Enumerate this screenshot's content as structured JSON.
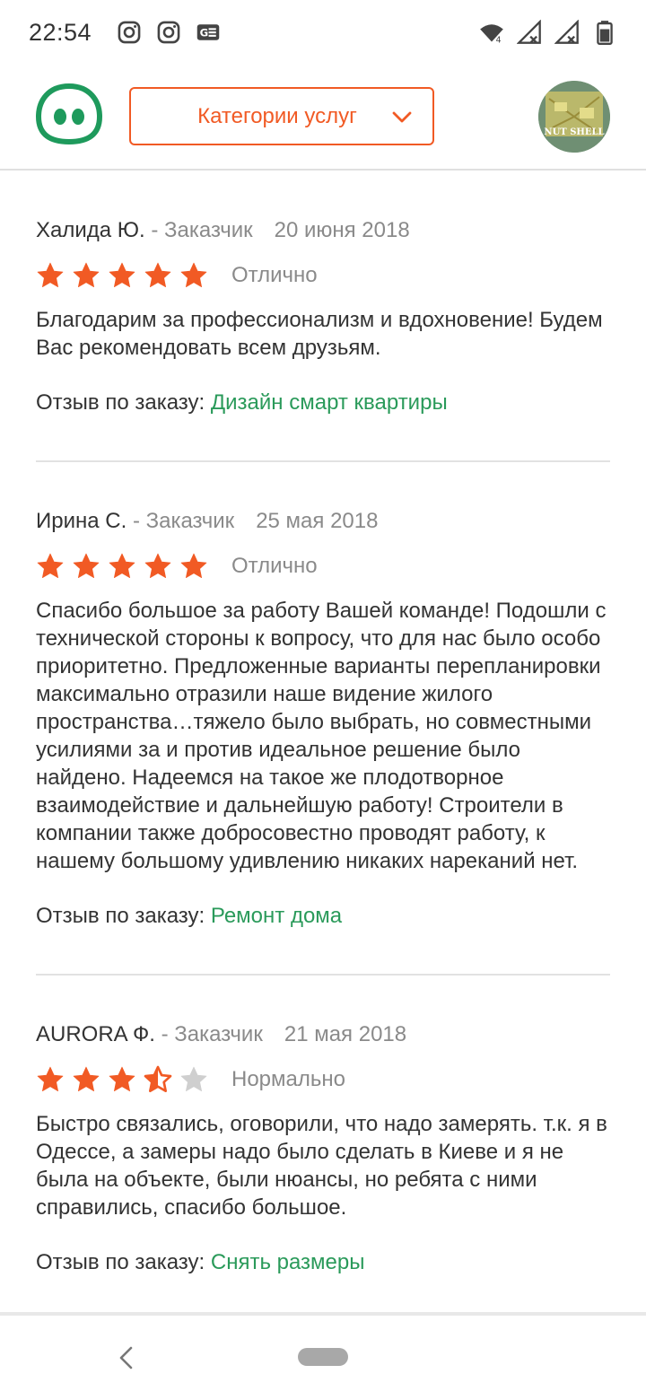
{
  "status_bar": {
    "time": "22:54",
    "icons_left": [
      "instagram-icon",
      "instagram-icon",
      "news-icon"
    ],
    "icons_right": [
      "wifi-icon",
      "signal-icon",
      "signal-icon",
      "battery-icon"
    ]
  },
  "header": {
    "category_label": "Категории услуг",
    "avatar_text": "NUT SHELL"
  },
  "colors": {
    "accent": "#f15a24",
    "link": "#2a9a5a",
    "logo": "#1e9a5c",
    "muted": "#8a8a8a"
  },
  "reviews": [
    {
      "author": "Халида Ю.",
      "role": " - Заказчик",
      "date": "20 июня 2018",
      "rating": 5,
      "rating_label": "Отлично",
      "text": "Благодарим за профессионализм и вдохновение! Будем Вас рекомендовать всем друзьям.",
      "order_prefix": "Отзыв по заказу: ",
      "order_link": "Дизайн смарт квартиры"
    },
    {
      "author": "Ирина С.",
      "role": " - Заказчик",
      "date": "25 мая 2018",
      "rating": 5,
      "rating_label": "Отлично",
      "text": "Спасибо большое за работу Вашей команде! Подошли с технической стороны к вопросу, что для нас было особо приоритетно. Предложенные варианты перепланировки максимально отразили наше видение жилого пространства…тяжело было выбрать, но совместными усилиями за и против идеальное решение было найдено. Надеемся на такое же плодотворное взаимодействие и дальнейшую работу! Строители в компании также добросовестно проводят работу, к нашему большому удивлению никаких нареканий нет.",
      "order_prefix": "Отзыв по заказу: ",
      "order_link": "Ремонт дома"
    },
    {
      "author": "AURORA Ф.",
      "role": " - Заказчик",
      "date": "21 мая 2018",
      "rating": 3.5,
      "rating_label": "Нормально",
      "text": "Быстро связались, оговорили, что надо замерять. т.к. я в Одессе, а замеры надо было сделать в Киеве и я не была на объекте, были нюансы, но ребята с ними справились, спасибо большое.",
      "order_prefix": "Отзыв по заказу: ",
      "order_link": "Снять размеры"
    }
  ],
  "nav": {
    "back_icon": "back-chevron-icon",
    "home_icon": "home-pill-icon"
  }
}
